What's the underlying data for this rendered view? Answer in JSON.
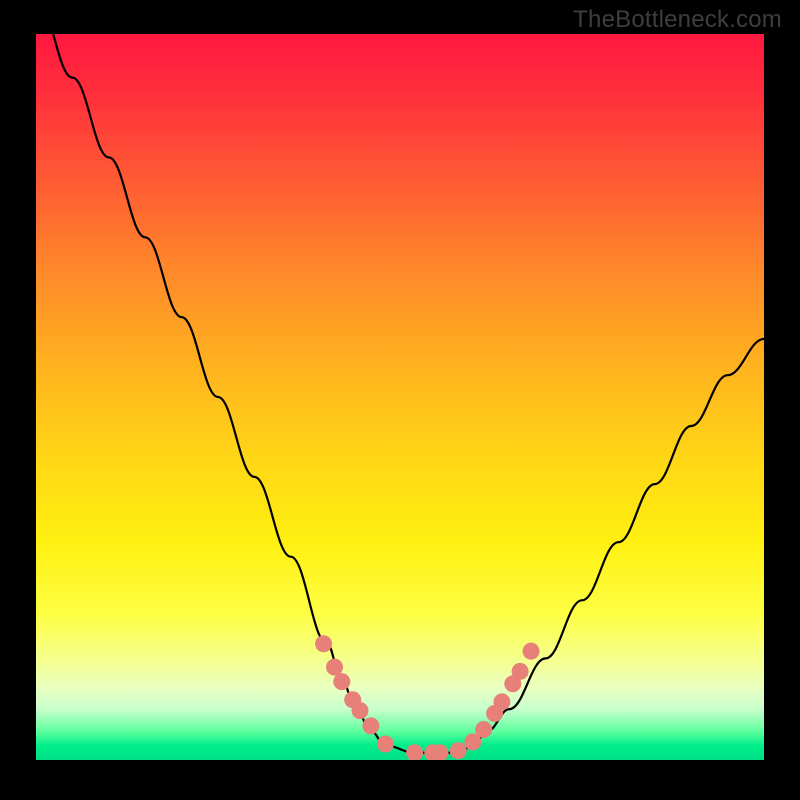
{
  "watermark": "TheBottleneck.com",
  "chart_data": {
    "type": "line",
    "title": "",
    "xlabel": "",
    "ylabel": "",
    "xlim": [
      0,
      1
    ],
    "ylim": [
      0,
      1
    ],
    "x": [
      0.0,
      0.05,
      0.1,
      0.15,
      0.2,
      0.25,
      0.3,
      0.35,
      0.4,
      0.42,
      0.44,
      0.46,
      0.48,
      0.52,
      0.55,
      0.58,
      0.6,
      0.62,
      0.65,
      0.7,
      0.75,
      0.8,
      0.85,
      0.9,
      0.95,
      1.0
    ],
    "y": [
      1.05,
      0.94,
      0.83,
      0.72,
      0.61,
      0.5,
      0.39,
      0.28,
      0.16,
      0.11,
      0.07,
      0.04,
      0.02,
      0.01,
      0.01,
      0.01,
      0.02,
      0.04,
      0.07,
      0.14,
      0.22,
      0.3,
      0.38,
      0.46,
      0.53,
      0.58
    ],
    "highlight_points": {
      "x": [
        0.395,
        0.41,
        0.42,
        0.435,
        0.445,
        0.46,
        0.48,
        0.52,
        0.545,
        0.555,
        0.58,
        0.6,
        0.615,
        0.63,
        0.64,
        0.655,
        0.665,
        0.68
      ],
      "y": [
        0.16,
        0.128,
        0.108,
        0.083,
        0.068,
        0.047,
        0.022,
        0.01,
        0.01,
        0.01,
        0.013,
        0.025,
        0.042,
        0.064,
        0.08,
        0.105,
        0.122,
        0.15
      ]
    },
    "background": {
      "type": "vertical_gradient",
      "colors": [
        "#ff183f",
        "#ffb31e",
        "#fff010",
        "#00df86"
      ]
    }
  }
}
